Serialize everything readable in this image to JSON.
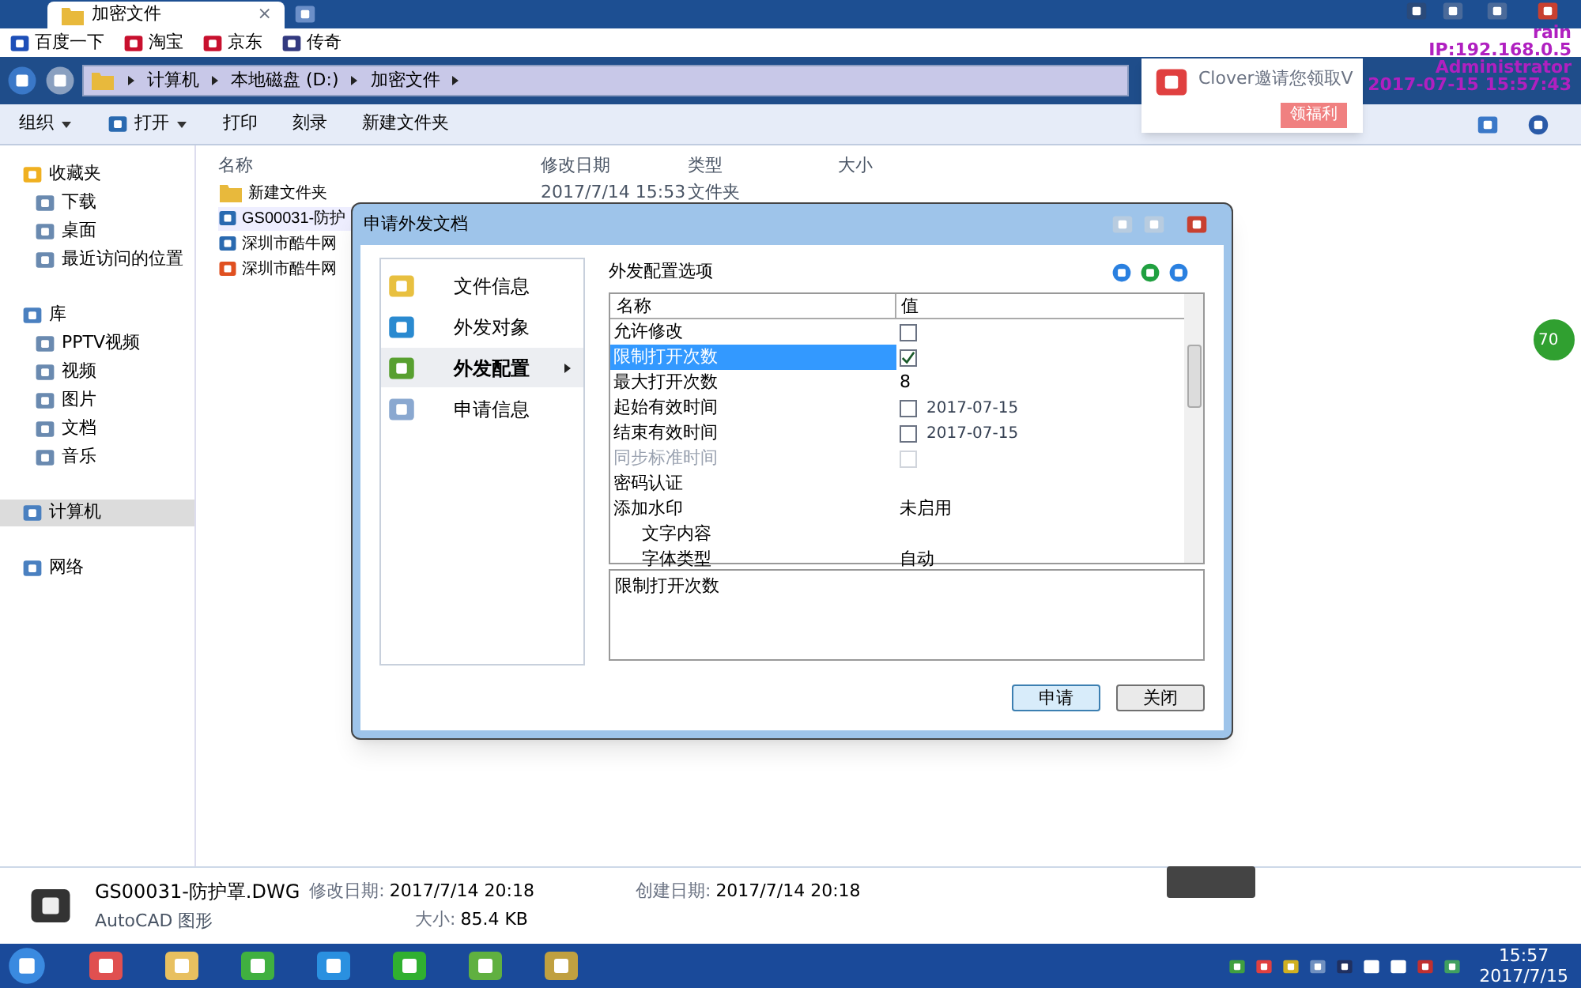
{
  "browser_tab": {
    "title": "加密文件",
    "close": "×"
  },
  "bookmarks": [
    "百度一下",
    "淘宝",
    "京东",
    "传奇"
  ],
  "breadcrumb": [
    "计算机",
    "本地磁盘 (D:)",
    "加密文件"
  ],
  "toolbar": [
    {
      "label": "组织",
      "menu": true
    },
    {
      "label": "打开",
      "menu": true
    },
    {
      "label": "打印",
      "menu": false
    },
    {
      "label": "刻录",
      "menu": false
    },
    {
      "label": "新建文件夹",
      "menu": false
    }
  ],
  "sidebar": [
    {
      "label": "收藏夹",
      "selected": false,
      "children": [
        {
          "label": "下载",
          "selected": false
        },
        {
          "label": "桌面",
          "selected": false
        },
        {
          "label": "最近访问的位置",
          "selected": false
        }
      ]
    },
    {
      "label": "库",
      "selected": false,
      "children": [
        {
          "label": "PPTV视频",
          "selected": false
        },
        {
          "label": "视频",
          "selected": false
        },
        {
          "label": "图片",
          "selected": false
        },
        {
          "label": "文档",
          "selected": false
        },
        {
          "label": "音乐",
          "selected": false
        }
      ]
    },
    {
      "label": "计算机",
      "selected": true
    },
    {
      "label": "网络",
      "selected": false
    }
  ],
  "columns": [
    "名称",
    "修改日期",
    "类型",
    "大小"
  ],
  "files": [
    {
      "name": "新建文件夹",
      "date": "2017/7/14 15:53",
      "type": "文件夹",
      "selected": false
    },
    {
      "name": "GS00031-防护",
      "selected": true
    },
    {
      "name": "深圳市酷牛网",
      "selected": false
    },
    {
      "name": "深圳市酷牛网",
      "selected": false
    }
  ],
  "dialog": {
    "title": "申请外发文档",
    "nav": [
      {
        "label": "文件信息",
        "selected": false
      },
      {
        "label": "外发对象",
        "selected": false
      },
      {
        "label": "外发配置",
        "selected": true
      },
      {
        "label": "申请信息",
        "selected": false
      }
    ],
    "section_title": "外发配置选项",
    "columns": [
      "名称",
      "值"
    ],
    "rows": [
      {
        "name": "允许修改",
        "kind": "check",
        "checked": false,
        "selected": false,
        "disabled": false
      },
      {
        "name": "限制打开次数",
        "kind": "check",
        "checked": true,
        "selected": true,
        "disabled": false
      },
      {
        "name": "最大打开次数",
        "kind": "text",
        "value": "8",
        "selected": false,
        "disabled": false
      },
      {
        "name": "起始有效时间",
        "kind": "check_date",
        "checked": false,
        "value": "2017-07-15",
        "selected": false,
        "disabled": false
      },
      {
        "name": "结束有效时间",
        "kind": "check_date",
        "checked": false,
        "value": "2017-07-15",
        "selected": false,
        "disabled": false
      },
      {
        "name": "同步标准时间",
        "kind": "check",
        "checked": false,
        "selected": false,
        "disabled": true
      },
      {
        "name": "密码认证",
        "kind": "text",
        "selected": false,
        "disabled": false
      },
      {
        "name": "添加水印",
        "kind": "text",
        "value": "未启用",
        "selected": false,
        "disabled": false,
        "children": [
          {
            "name": "文字内容",
            "kind": "text",
            "selected": false,
            "disabled": false
          },
          {
            "name": "字体类型",
            "kind": "text",
            "value": "自动",
            "selected": false,
            "disabled": false
          }
        ]
      }
    ],
    "description": "限制打开次数",
    "buttons": [
      "申请",
      "关闭"
    ]
  },
  "notification": {
    "text": "Clover邀请您领取V",
    "button": "领福利"
  },
  "overlay_info": [
    "rain",
    "IP:192.168.0.5",
    "Administrator",
    "2017-07-15 15:57:43"
  ],
  "side_badge": "70",
  "details": {
    "name": "GS00031-防护罩.DWG",
    "type": "AutoCAD 图形",
    "fields": [
      {
        "label": "修改日期:",
        "value": "2017/7/14 20:18"
      },
      {
        "label": "创建日期:",
        "value": "2017/7/14 20:18"
      },
      {
        "label": "大小:",
        "value": "85.4 KB"
      }
    ]
  },
  "clock": {
    "time": "15:57",
    "date": "2017/7/15"
  }
}
